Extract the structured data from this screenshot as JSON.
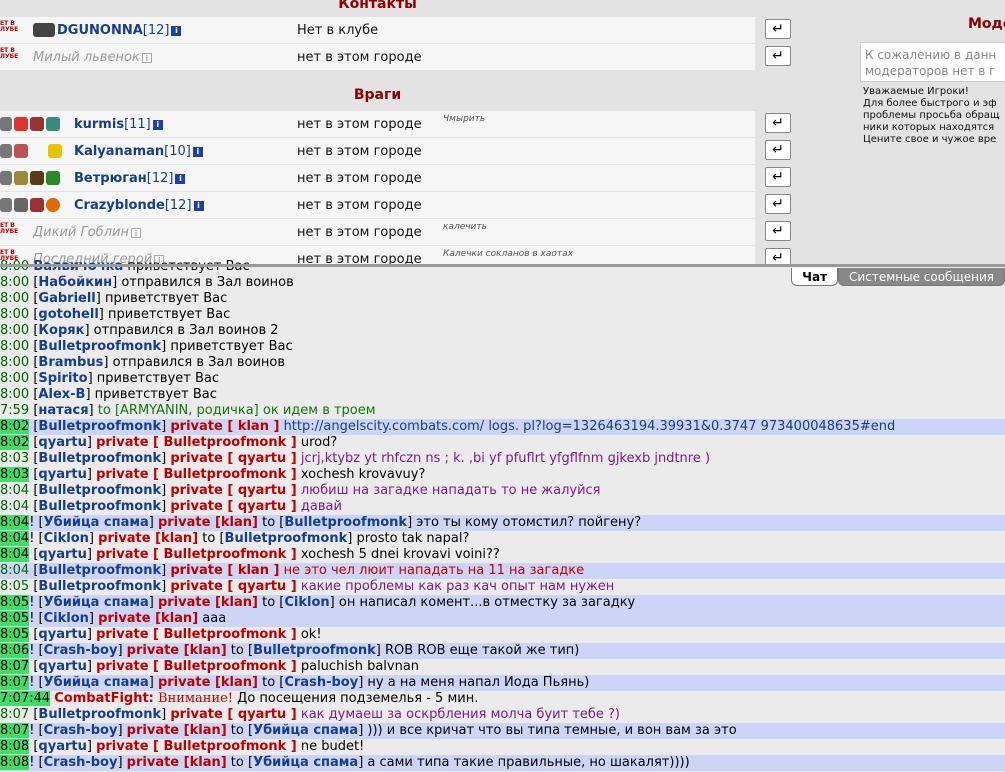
{
  "contacts": {
    "title": "Контакты",
    "rows": [
      {
        "badge": "ЕТ В ЛУБЕ",
        "nick": "DGUNONNA",
        "level": "[12]",
        "status": "Нет в клубе",
        "online": true
      },
      {
        "badge": "ЕТ В ЛУБЕ",
        "nick": "Милый львенок",
        "level": "",
        "status": "нет в этом городе",
        "online": false
      }
    ]
  },
  "enemies": {
    "title": "Враги",
    "rows": [
      {
        "nick": "kurmis",
        "level": "[11]",
        "status": "нет в этом городе",
        "note": "Чмырить",
        "online": true
      },
      {
        "nick": "Kalyanaman",
        "level": "[10]",
        "status": "нет в этом городе",
        "note": "",
        "online": true
      },
      {
        "nick": "Ветрюган",
        "level": "[12]",
        "status": "нет в этом городе",
        "note": "",
        "online": true
      },
      {
        "nick": "Crazyblonde",
        "level": "[12]",
        "status": "нет в этом городе",
        "note": "",
        "online": true
      },
      {
        "badge": "ЕТ В ЛУБЕ",
        "nick": "Дикий Гоблин",
        "level": "",
        "status": "нет в этом городе",
        "note": "калечить",
        "online": false
      },
      {
        "badge": "ЕТ В ЛУБЕ",
        "nick": "Последний герой",
        "level": "",
        "status": "нет в этом городе",
        "note": "Калечки сокланов в хаотах",
        "online": false
      }
    ]
  },
  "moderators": {
    "title": "Моде",
    "box_text": "К сожалению в данн\nмодераторов нет в г",
    "notice": "Уважаемые Игроки!\nДля более быстрого и эф\nпроблемы просьба обращ\nники которых находятся\nЦените свое и чужое вре"
  },
  "tabs": [
    "Чат",
    "Системные сообщения"
  ],
  "chat": [
    {
      "hl": false,
      "segs": [
        [
          "t",
          "8:00"
        ],
        [
          "x",
          " "
        ],
        [
          "nk",
          "Валвичочка"
        ],
        [
          "x",
          " приветствует Вас"
        ]
      ]
    },
    {
      "hl": false,
      "segs": [
        [
          "t",
          "8:00"
        ],
        [
          "x",
          " ["
        ],
        [
          "nk",
          "Набойкин"
        ],
        [
          "x",
          "] отправился в Зал воинов"
        ]
      ]
    },
    {
      "hl": false,
      "segs": [
        [
          "t",
          "8:00"
        ],
        [
          "x",
          " ["
        ],
        [
          "nk",
          "Gabriell"
        ],
        [
          "x",
          "] приветствует Вас"
        ]
      ]
    },
    {
      "hl": false,
      "segs": [
        [
          "t",
          "8:00"
        ],
        [
          "x",
          " ["
        ],
        [
          "nk",
          "gotohell"
        ],
        [
          "x",
          "] приветствует Вас"
        ]
      ]
    },
    {
      "hl": false,
      "segs": [
        [
          "t",
          "8:00"
        ],
        [
          "x",
          " ["
        ],
        [
          "nk",
          "Коряк"
        ],
        [
          "x",
          "] отправился в Зал воинов 2"
        ]
      ]
    },
    {
      "hl": false,
      "segs": [
        [
          "t",
          "8:00"
        ],
        [
          "x",
          " ["
        ],
        [
          "nk",
          "Bulletproofmonk"
        ],
        [
          "x",
          "] приветствует Вас"
        ]
      ]
    },
    {
      "hl": false,
      "segs": [
        [
          "t",
          "8:00"
        ],
        [
          "x",
          " ["
        ],
        [
          "nk",
          "Brambus"
        ],
        [
          "x",
          "] отправился в Зал воинов"
        ]
      ]
    },
    {
      "hl": false,
      "segs": [
        [
          "t",
          "8:00"
        ],
        [
          "x",
          " ["
        ],
        [
          "nk",
          "Spirito"
        ],
        [
          "x",
          "] приветствует Вас"
        ]
      ]
    },
    {
      "hl": false,
      "segs": [
        [
          "t",
          "8:00"
        ],
        [
          "x",
          " ["
        ],
        [
          "nk",
          "Alex-B"
        ],
        [
          "x",
          "] приветствует Вас"
        ]
      ]
    },
    {
      "hl": false,
      "segs": [
        [
          "t",
          "7:59"
        ],
        [
          "x",
          " ["
        ],
        [
          "nk",
          "натася"
        ],
        [
          "x",
          "] "
        ],
        [
          "gm",
          "to [ARMYANIN, родичка] ок идем в троем"
        ]
      ]
    },
    {
      "hl": true,
      "segs": [
        [
          "tb",
          "8:02"
        ],
        [
          "x",
          " ["
        ],
        [
          "nk",
          "Bulletproofmonk"
        ],
        [
          "x",
          "] "
        ],
        [
          "pv",
          "private [ klan ]"
        ],
        [
          "x",
          " "
        ],
        [
          "lk",
          "http://angelscity.combats.com/ logs. pl?log=1326463194.39931&0.3747 973400048635#end"
        ]
      ]
    },
    {
      "hl": false,
      "segs": [
        [
          "tb",
          "8:02"
        ],
        [
          "x",
          " ["
        ],
        [
          "nk",
          "qyartu"
        ],
        [
          "x",
          "] "
        ],
        [
          "pv",
          "private [ Bulletproofmonk ]"
        ],
        [
          "x",
          " urod?"
        ]
      ]
    },
    {
      "hl": false,
      "segs": [
        [
          "t",
          "8:03"
        ],
        [
          "x",
          " ["
        ],
        [
          "nk",
          "Bulletproofmonk"
        ],
        [
          "x",
          "] "
        ],
        [
          "pv",
          "private [ qyartu ]"
        ],
        [
          "x",
          " "
        ],
        [
          "pl",
          "jcrj,ktybz yt rhfczn ns ; k. ,bi yf pfuflrt yfgflfnm gjkexb jndtnre )"
        ]
      ]
    },
    {
      "hl": false,
      "segs": [
        [
          "tb",
          "8:03"
        ],
        [
          "x",
          " ["
        ],
        [
          "nk",
          "qyartu"
        ],
        [
          "x",
          "] "
        ],
        [
          "pv",
          "private [ Bulletproofmonk ]"
        ],
        [
          "x",
          " xochesh krovavuy?"
        ]
      ]
    },
    {
      "hl": false,
      "segs": [
        [
          "t",
          "8:04"
        ],
        [
          "x",
          " ["
        ],
        [
          "nk",
          "Bulletproofmonk"
        ],
        [
          "x",
          "] "
        ],
        [
          "pv",
          "private [ qyartu ]"
        ],
        [
          "x",
          " "
        ],
        [
          "pl",
          "любиш на загадке нападать то не жалуйся"
        ]
      ]
    },
    {
      "hl": false,
      "segs": [
        [
          "t",
          "8:04"
        ],
        [
          "x",
          " ["
        ],
        [
          "nk",
          "Bulletproofmonk"
        ],
        [
          "x",
          "] "
        ],
        [
          "pv",
          "private [ qyartu ]"
        ],
        [
          "x",
          " "
        ],
        [
          "pl",
          "давай"
        ]
      ]
    },
    {
      "hl": true,
      "segs": [
        [
          "tb",
          "8:04"
        ],
        [
          "x",
          "! ["
        ],
        [
          "nk",
          "Убийца спама"
        ],
        [
          "x",
          "] "
        ],
        [
          "pv",
          "private [klan]"
        ],
        [
          "x",
          " to ["
        ],
        [
          "nk",
          "Bulletproofmonk"
        ],
        [
          "x",
          "] это ты кому отомстил? пойгену?"
        ]
      ]
    },
    {
      "hl": false,
      "segs": [
        [
          "tb",
          "8:04"
        ],
        [
          "x",
          "! ["
        ],
        [
          "nk",
          "Ciklon"
        ],
        [
          "x",
          "] "
        ],
        [
          "pv",
          "private [klan]"
        ],
        [
          "x",
          " to ["
        ],
        [
          "nk",
          "Bulletproofmonk"
        ],
        [
          "x",
          "] prosto tak napal?"
        ]
      ]
    },
    {
      "hl": false,
      "segs": [
        [
          "tb",
          "8:04"
        ],
        [
          "x",
          " ["
        ],
        [
          "nk",
          "qyartu"
        ],
        [
          "x",
          "] "
        ],
        [
          "pv",
          "private [ Bulletproofmonk ]"
        ],
        [
          "x",
          " xochesh 5 dnei krovavi voini??"
        ]
      ]
    },
    {
      "hl": true,
      "segs": [
        [
          "t",
          "8:04"
        ],
        [
          "x",
          " ["
        ],
        [
          "nk",
          "Bulletproofmonk"
        ],
        [
          "x",
          "] "
        ],
        [
          "pv",
          "private [ klan ]"
        ],
        [
          "x",
          " "
        ],
        [
          "pm",
          "не это чел люит нападать на 11 на загадке"
        ]
      ]
    },
    {
      "hl": false,
      "segs": [
        [
          "t",
          "8:05"
        ],
        [
          "x",
          " ["
        ],
        [
          "nk",
          "Bulletproofmonk"
        ],
        [
          "x",
          "] "
        ],
        [
          "pv",
          "private [ qyartu ]"
        ],
        [
          "x",
          " "
        ],
        [
          "pl",
          "какие проблемы как раз кач опыт нам нужен"
        ]
      ]
    },
    {
      "hl": true,
      "segs": [
        [
          "tb",
          "8:05"
        ],
        [
          "x",
          "! ["
        ],
        [
          "nk",
          "Убийца спама"
        ],
        [
          "x",
          "] "
        ],
        [
          "pv",
          "private [klan]"
        ],
        [
          "x",
          " to ["
        ],
        [
          "nk",
          "Ciklon"
        ],
        [
          "x",
          "] он написал комент...в отместку за загадку"
        ]
      ]
    },
    {
      "hl": true,
      "segs": [
        [
          "tb",
          "8:05"
        ],
        [
          "x",
          "! ["
        ],
        [
          "nk",
          "Ciklon"
        ],
        [
          "x",
          "] "
        ],
        [
          "pv",
          "private [klan]"
        ],
        [
          "x",
          " aaa"
        ]
      ]
    },
    {
      "hl": false,
      "segs": [
        [
          "tb",
          "8:05"
        ],
        [
          "x",
          " ["
        ],
        [
          "nk",
          "qyartu"
        ],
        [
          "x",
          "] "
        ],
        [
          "pv",
          "private [ Bulletproofmonk ]"
        ],
        [
          "x",
          " ok!"
        ]
      ]
    },
    {
      "hl": true,
      "segs": [
        [
          "tb",
          "8:06"
        ],
        [
          "x",
          "! ["
        ],
        [
          "nk",
          "Crash-boy"
        ],
        [
          "x",
          "] "
        ],
        [
          "pv",
          "private [klan]"
        ],
        [
          "x",
          " to ["
        ],
        [
          "nk",
          "Bulletproofmonk"
        ],
        [
          "x",
          "] ROB ROB еще такой же тип)"
        ]
      ]
    },
    {
      "hl": false,
      "segs": [
        [
          "tb",
          "8:07"
        ],
        [
          "x",
          " ["
        ],
        [
          "nk",
          "qyartu"
        ],
        [
          "x",
          "] "
        ],
        [
          "pv",
          "private [ Bulletproofmonk ]"
        ],
        [
          "x",
          " paluchish balvnan"
        ]
      ]
    },
    {
      "hl": true,
      "segs": [
        [
          "tb",
          "8:07"
        ],
        [
          "x",
          "! ["
        ],
        [
          "nk",
          "Убийца спама"
        ],
        [
          "x",
          "] "
        ],
        [
          "pv",
          "private [klan]"
        ],
        [
          "x",
          " to ["
        ],
        [
          "nk",
          "Crash-boy"
        ],
        [
          "x",
          "] ну а на меня напал Йода Пьянь)"
        ]
      ]
    },
    {
      "hl": false,
      "segs": [
        [
          "tb",
          "7:07:44"
        ],
        [
          "x",
          " "
        ],
        [
          "cf",
          "CombatFight:"
        ],
        [
          "x",
          " "
        ],
        [
          "at",
          "Внимание!"
        ],
        [
          "x",
          " До посещения подземелья - 5 мин."
        ]
      ]
    },
    {
      "hl": false,
      "segs": [
        [
          "t",
          "8:07"
        ],
        [
          "x",
          " ["
        ],
        [
          "nk",
          "Bulletproofmonk"
        ],
        [
          "x",
          "] "
        ],
        [
          "pv",
          "private [ qyartu ]"
        ],
        [
          "x",
          " "
        ],
        [
          "pl",
          "как думаеш за оскрбления молча буит тебе ?)"
        ]
      ]
    },
    {
      "hl": true,
      "segs": [
        [
          "tb",
          "8:07"
        ],
        [
          "x",
          "! ["
        ],
        [
          "nk",
          "Crash-boy"
        ],
        [
          "x",
          "] "
        ],
        [
          "pv",
          "private [klan]"
        ],
        [
          "x",
          " to ["
        ],
        [
          "nk",
          "Убийца спама"
        ],
        [
          "x",
          "] ))) и все кричат что вы типа темные, и вон вам за это"
        ]
      ]
    },
    {
      "hl": false,
      "segs": [
        [
          "tb",
          "8:08"
        ],
        [
          "x",
          " ["
        ],
        [
          "nk",
          "qyartu"
        ],
        [
          "x",
          "] "
        ],
        [
          "pv",
          "private [ Bulletproofmonk ]"
        ],
        [
          "x",
          " ne budet!"
        ]
      ]
    },
    {
      "hl": true,
      "segs": [
        [
          "tb",
          "8:08"
        ],
        [
          "x",
          "! ["
        ],
        [
          "nk",
          "Crash-boy"
        ],
        [
          "x",
          "] "
        ],
        [
          "pv",
          "private [klan]"
        ],
        [
          "x",
          " to ["
        ],
        [
          "nk",
          "Убийца спама"
        ],
        [
          "x",
          "] а сами типа такие правильные, но шакалят))))"
        ]
      ]
    }
  ]
}
